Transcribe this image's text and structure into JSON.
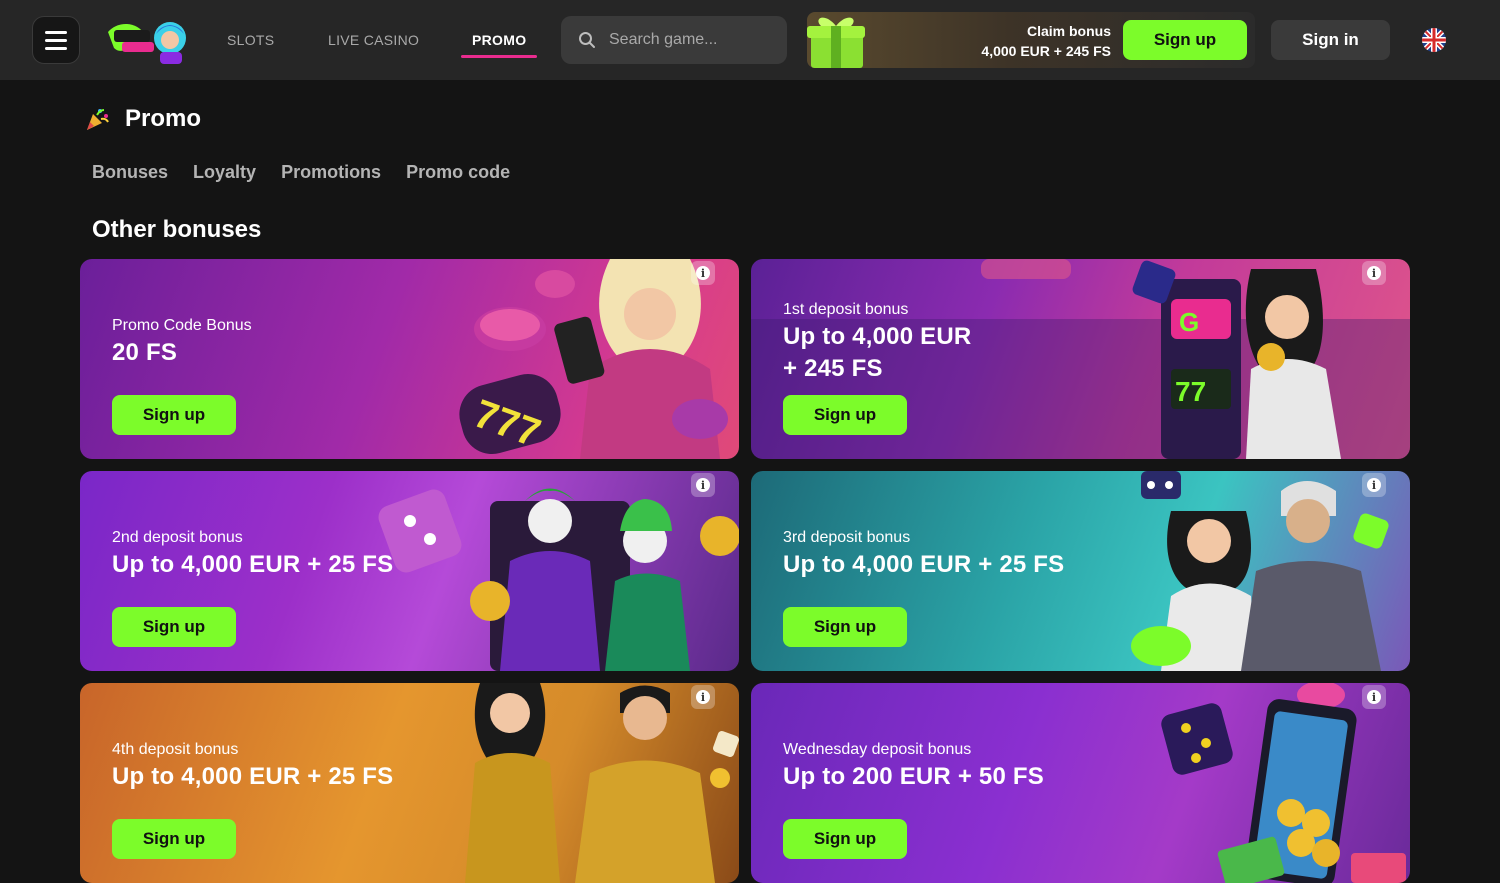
{
  "header": {
    "nav": [
      {
        "label": "SLOTS"
      },
      {
        "label": "LIVE CASINO"
      },
      {
        "label": "PROMO",
        "active": true
      }
    ],
    "search": {
      "placeholder": "Search game..."
    },
    "claim": {
      "title": "Claim bonus",
      "amount": "4,000 EUR + 245 FS",
      "button": "Sign up"
    },
    "signin": "Sign in",
    "language_icon": "uk-flag-icon",
    "accent_color": "#7cfc2a",
    "active_tab_color": "#e92c8f"
  },
  "page": {
    "title": "Promo",
    "title_icon": "party-popper-icon",
    "tabs": [
      "Bonuses",
      "Loyalty",
      "Promotions",
      "Promo code"
    ],
    "section_title": "Other bonuses"
  },
  "cards": [
    {
      "label": "Promo Code Bonus",
      "value": "20 FS",
      "button": "Sign up"
    },
    {
      "label": "1st deposit bonus",
      "value_line1": "Up to 4,000 EUR",
      "value_line2": "+ 245 FS",
      "button": "Sign up"
    },
    {
      "label": "2nd deposit bonus",
      "value": "Up to 4,000 EUR + 25 FS",
      "button": "Sign up"
    },
    {
      "label": "3rd deposit bonus",
      "value": "Up to 4,000 EUR + 25 FS",
      "button": "Sign up"
    },
    {
      "label": "4th deposit bonus",
      "value": "Up to 4,000 EUR + 25 FS",
      "button": "Sign up"
    },
    {
      "label": "Wednesday deposit bonus",
      "value": "Up to 200 EUR + 50 FS",
      "button": "Sign up"
    }
  ]
}
